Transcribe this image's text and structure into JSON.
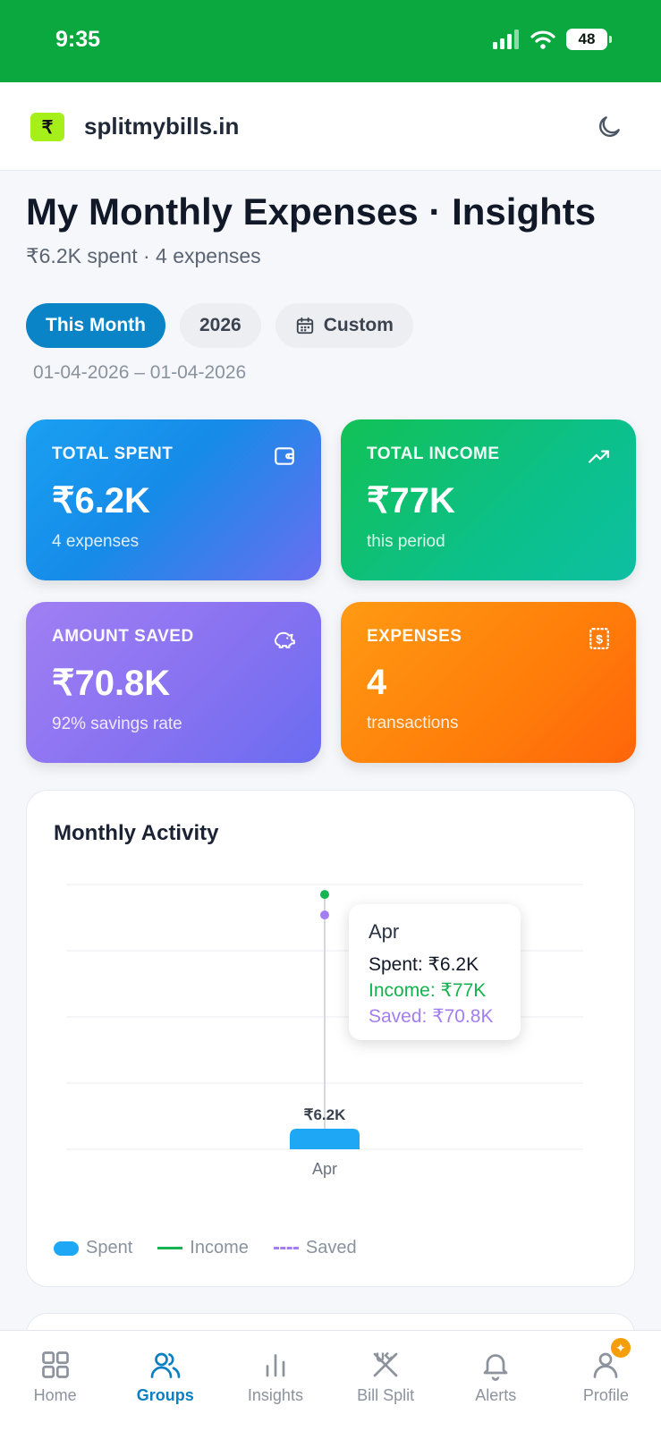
{
  "status": {
    "time": "9:35",
    "battery": "48"
  },
  "header": {
    "brand": "splitmybills.in",
    "logo_glyph": "₹"
  },
  "page": {
    "title": "My Monthly Expenses · Insights",
    "subtitle": "₹6.2K spent · 4 expenses"
  },
  "filters": {
    "this_month": "This Month",
    "year": "2026",
    "custom": "Custom",
    "date_range": "01-04-2026 – 01-04-2026"
  },
  "cards": {
    "spent": {
      "label": "TOTAL SPENT",
      "value": "₹6.2K",
      "sub": "4 expenses"
    },
    "income": {
      "label": "TOTAL INCOME",
      "value": "₹77K",
      "sub": "this period"
    },
    "saved": {
      "label": "AMOUNT SAVED",
      "value": "₹70.8K",
      "sub": "92% savings rate"
    },
    "expenses": {
      "label": "EXPENSES",
      "value": "4",
      "sub": "transactions"
    }
  },
  "chart": {
    "title": "Monthly Activity",
    "bar_label": "₹6.2K",
    "x_tick": "Apr",
    "tooltip": {
      "month": "Apr",
      "spent": "Spent: ₹6.2K",
      "income": "Income: ₹77K",
      "saved": "Saved: ₹70.8K"
    },
    "legend": {
      "spent": "Spent",
      "income": "Income",
      "saved": "Saved"
    }
  },
  "chart_data": {
    "type": "bar",
    "categories": [
      "Apr"
    ],
    "series": [
      {
        "name": "Spent",
        "values": [
          6.2
        ],
        "style": "bar",
        "color": "#1ea7f5"
      },
      {
        "name": "Income",
        "values": [
          77
        ],
        "style": "line",
        "color": "#16b551"
      },
      {
        "name": "Saved",
        "values": [
          70.8
        ],
        "style": "dashed-line",
        "color": "#a37ef2"
      }
    ],
    "ylim": [
      0,
      80
    ],
    "grid": true,
    "legend": "bottom-left"
  },
  "nav": {
    "home": "Home",
    "groups": "Groups",
    "insights": "Insights",
    "bill_split": "Bill Split",
    "alerts": "Alerts",
    "profile": "Profile"
  },
  "colors": {
    "status_bar": "#0aa83f",
    "accent": "#0a84c6",
    "logo": "#a5f01a"
  }
}
